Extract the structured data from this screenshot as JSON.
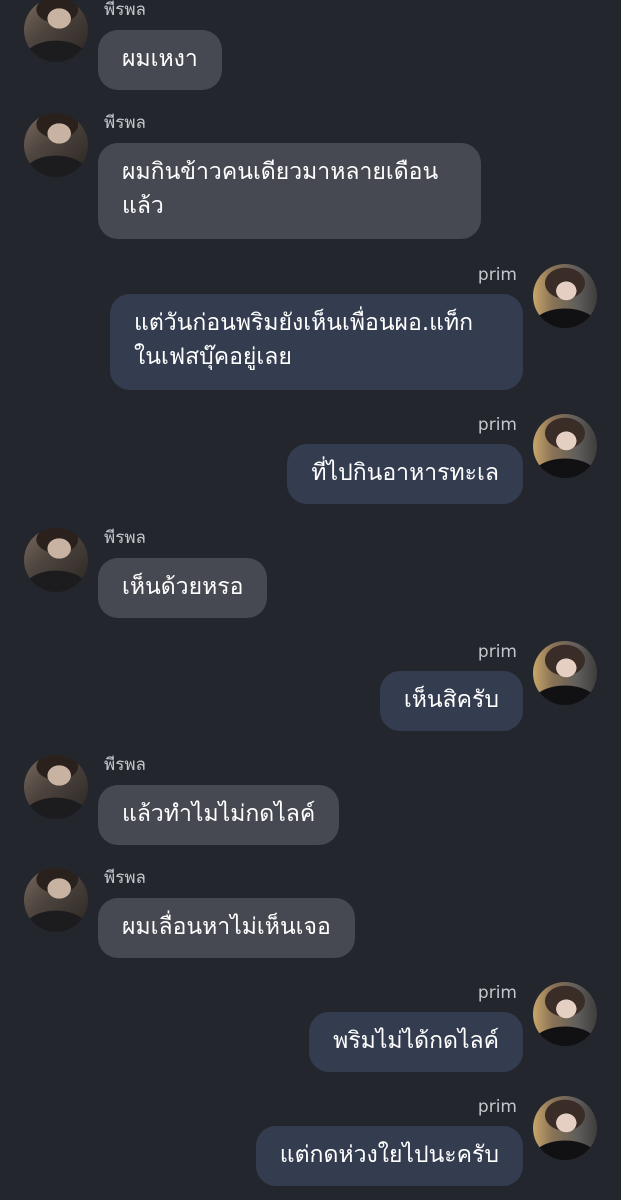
{
  "messages": [
    {
      "sender": "พีรพล",
      "text": "ผมเหงา"
    },
    {
      "sender": "พีรพล",
      "text": "ผมกินข้าวคนเดียวมาหลายเดือน\nแล้ว"
    },
    {
      "sender": "prim",
      "text": "แต่วันก่อนพริมยังเห็นเพื่อนผอ.แท็ก\nในเฟสบุ๊คอยู่เลย"
    },
    {
      "sender": "prim",
      "text": "ที่ไปกินอาหารทะเล"
    },
    {
      "sender": "พีรพล",
      "text": "เห็นด้วยหรอ"
    },
    {
      "sender": "prim",
      "text": "เห็นสิครับ"
    },
    {
      "sender": "พีรพล",
      "text": "แล้วทำไมไม่กดไลค์"
    },
    {
      "sender": "พีรพล",
      "text": "ผมเลื่อนหาไม่เห็นเจอ"
    },
    {
      "sender": "prim",
      "text": "พริมไม่ได้กดไลค์"
    },
    {
      "sender": "prim",
      "text": "แต่กดห่วงใยไปนะครับ"
    }
  ]
}
